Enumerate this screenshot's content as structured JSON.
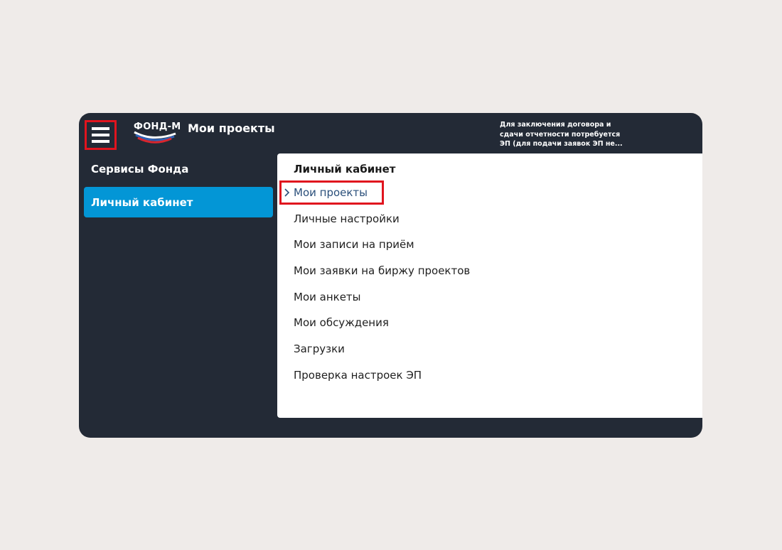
{
  "header": {
    "logo_text": "ФОНД-М",
    "page_title": "Мои проекты",
    "notice": "Для заключения договора и сдачи отчетности потребуется ЭП (для подачи заявок ЭП не..."
  },
  "sidebar": {
    "heading": "Сервисы Фонда",
    "items": [
      {
        "label": "Личный кабинет"
      }
    ]
  },
  "panel": {
    "heading": "Личный кабинет",
    "items": [
      {
        "label": "Мои проекты"
      },
      {
        "label": "Личные настройки"
      },
      {
        "label": "Мои записи на приём"
      },
      {
        "label": "Мои заявки на биржу проектов"
      },
      {
        "label": "Мои анкеты"
      },
      {
        "label": "Мои обсуждения"
      },
      {
        "label": "Загрузки"
      },
      {
        "label": "Проверка настроек ЭП"
      }
    ]
  },
  "colors": {
    "page_background": "#efebe9",
    "window_background": "#232a36",
    "sidebar_active": "#0396d6",
    "highlight_frame": "#e0141e",
    "active_link": "#2a4f7a"
  },
  "icons": {
    "menu_toggle": "hamburger-icon",
    "active_marker": "chevron-right-icon"
  }
}
